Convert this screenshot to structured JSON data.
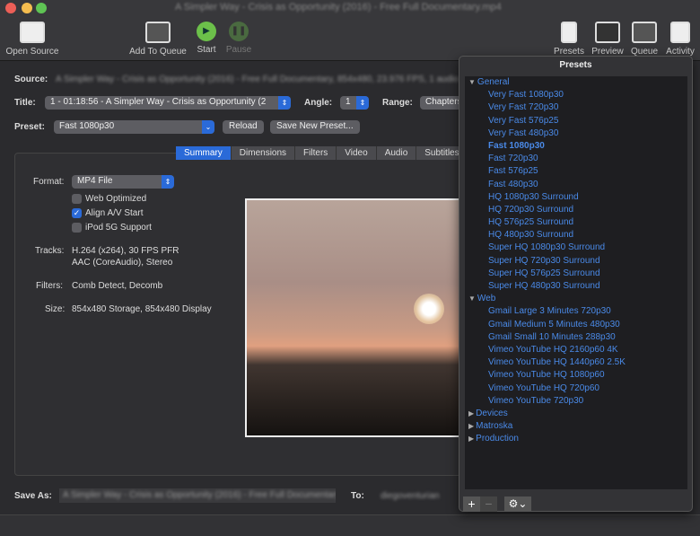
{
  "window": {
    "title": "A Simpler Way - Crisis as Opportunity (2016) - Free Full Documentary.mp4"
  },
  "toolbar": {
    "open_source": "Open Source",
    "add_to_queue": "Add To Queue",
    "start": "Start",
    "pause": "Pause",
    "presets": "Presets",
    "preview": "Preview",
    "queue": "Queue",
    "activity": "Activity"
  },
  "source": {
    "label": "Source:",
    "value": "A Simpler Way - Crisis as Opportunity (2016) - Free Full Documentary, 854x480, 23.976 FPS, 1 audio"
  },
  "title_row": {
    "label": "Title:",
    "value": "1 - 01:18:56 - A Simpler Way - Crisis as Opportunity (2",
    "angle_label": "Angle:",
    "angle_value": "1",
    "range_label": "Range:",
    "range_value": "Chapters"
  },
  "preset_row": {
    "label": "Preset:",
    "value": "Fast 1080p30",
    "reload": "Reload",
    "save_new": "Save New Preset..."
  },
  "tabs": [
    "Summary",
    "Dimensions",
    "Filters",
    "Video",
    "Audio",
    "Subtitles"
  ],
  "summary": {
    "format_label": "Format:",
    "format_value": "MP4 File",
    "web_optimized": "Web Optimized",
    "align_av": "Align A/V Start",
    "ipod": "iPod 5G Support",
    "tracks_label": "Tracks:",
    "tracks_1": "H.264 (x264), 30 FPS PFR",
    "tracks_2": "AAC (CoreAudio), Stereo",
    "filters_label": "Filters:",
    "filters_value": "Comb Detect, Decomb",
    "size_label": "Size:",
    "size_value": "854x480 Storage, 854x480 Display"
  },
  "save": {
    "label": "Save As:",
    "value": "A Simpler Way - Crisis as Opportunity (2016) - Free Full Documentary",
    "to_label": "To:",
    "to_value": "diegoventurian"
  },
  "presets_panel": {
    "title": "Presets",
    "groups": [
      {
        "name": "General",
        "expanded": true,
        "items": [
          "Very Fast 1080p30",
          "Very Fast 720p30",
          "Very Fast 576p25",
          "Very Fast 480p30",
          "Fast 1080p30",
          "Fast 720p30",
          "Fast 576p25",
          "Fast 480p30",
          "HQ 1080p30 Surround",
          "HQ 720p30 Surround",
          "HQ 576p25 Surround",
          "HQ 480p30 Surround",
          "Super HQ 1080p30 Surround",
          "Super HQ 720p30 Surround",
          "Super HQ 576p25 Surround",
          "Super HQ 480p30 Surround"
        ]
      },
      {
        "name": "Web",
        "expanded": true,
        "items": [
          "Gmail Large 3 Minutes 720p30",
          "Gmail Medium 5 Minutes 480p30",
          "Gmail Small 10 Minutes 288p30",
          "Vimeo YouTube HQ 2160p60 4K",
          "Vimeo YouTube HQ 1440p60 2.5K",
          "Vimeo YouTube HQ 1080p60",
          "Vimeo YouTube HQ 720p60",
          "Vimeo YouTube 720p30"
        ]
      },
      {
        "name": "Devices",
        "expanded": false,
        "items": []
      },
      {
        "name": "Matroska",
        "expanded": false,
        "items": []
      },
      {
        "name": "Production",
        "expanded": false,
        "items": []
      }
    ],
    "selected": "Fast 1080p30",
    "add": "+",
    "remove": "−"
  },
  "colors": {
    "accent": "#2a6ad8",
    "preset_text": "#4a8ae8"
  }
}
